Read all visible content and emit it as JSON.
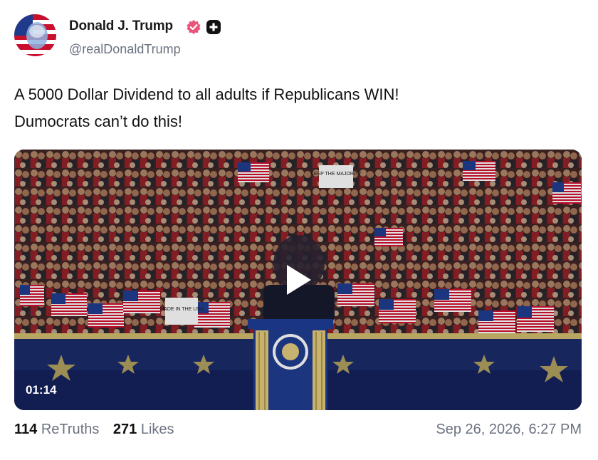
{
  "author": {
    "name": "Donald J. Trump",
    "handle": "@realDonaldTrump"
  },
  "post": {
    "text_lines": [
      "A 5000 Dollar Dividend to all adults if Republicans WIN!",
      "Dumocrats can’t do this!"
    ]
  },
  "media": {
    "duration": "01:14",
    "crowd_signs": [
      "KEEP THE MAJORITY",
      "MADE IN THE USA"
    ]
  },
  "stats": {
    "retruths_count": "114",
    "retruths_label": "ReTruths",
    "likes_count": "271",
    "likes_label": "Likes"
  },
  "timestamp": "Sep 26, 2026, 6:27 PM",
  "colors": {
    "verified_badge": "#e9557a",
    "text_primary": "#111111",
    "text_secondary": "#6b7280",
    "stage_blue": "#1f3a8a",
    "stage_gold": "#d9c27a"
  },
  "icons": {
    "verified": "verified-badge-icon",
    "badge": "plus-badge-icon",
    "play": "play-icon"
  }
}
